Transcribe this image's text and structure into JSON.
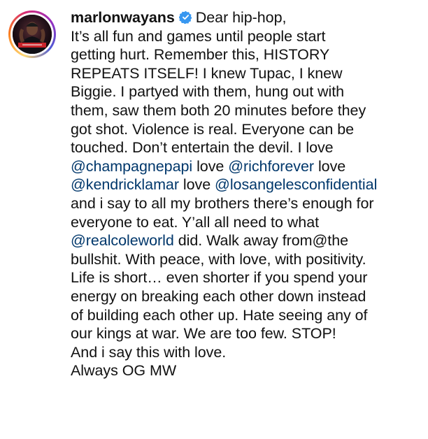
{
  "post": {
    "username": "marlonwayans",
    "avatar_icon": "profile-photo",
    "verified_icon": "verified-badge-icon",
    "colors": {
      "text": "#111111",
      "mention": "#00376b",
      "verified": "#3897f0"
    },
    "caption": {
      "l1_text": "Dear hip-hop,",
      "l2": "It’s all fun and games until people start",
      "l3": "getting hurt. Remember this, HISTORY",
      "l4": "REPEATS ITSELF! I knew Tupac, I knew",
      "l5": "Biggie. I partyed with them, hung out with",
      "l6": "them, saw them both 20 minutes before they",
      "l7": "got shot. Violence is real. Everyone can be",
      "l8": "touched. Don’t entertain the devil. I love",
      "l9_m1": "@champagnepapi",
      "l9_t1": " love ",
      "l9_m2": "@richforever",
      "l9_t2": " love",
      "l10_m1": "@kendricklamar",
      "l10_t1": " love ",
      "l10_m2": "@losangelesconfidential",
      "l11": "and i say to all my brothers there’s enough for",
      "l12": "everyone to eat. Y’all all need to what",
      "l13_m1": "@realcoleworld",
      "l13_t1": " did. Walk away from@the",
      "l14": "bullshit. With peace, with love, with positivity.",
      "l15": "Life is short… even shorter if you spend your",
      "l16": "energy on breaking each other down instead",
      "l17": "of building each other up. Hate seeing any of",
      "l18": "our kings at war. We are too few. STOP!",
      "l19": "And i say this with love.",
      "l20": "Always OG MW"
    }
  }
}
